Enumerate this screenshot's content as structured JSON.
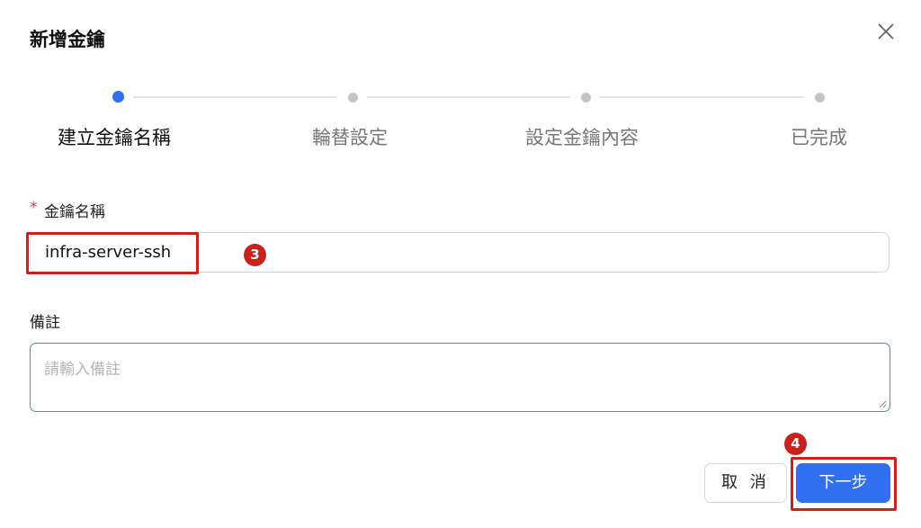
{
  "dialog": {
    "title": "新增金鑰",
    "close_icon": "close-icon"
  },
  "steps": [
    {
      "label": "建立金鑰名稱",
      "state": "active"
    },
    {
      "label": "輪替設定",
      "state": "pending"
    },
    {
      "label": "設定金鑰內容",
      "state": "pending"
    },
    {
      "label": "已完成",
      "state": "pending"
    }
  ],
  "form": {
    "key_name": {
      "required_mark": "*",
      "label": "金鑰名稱",
      "value": "infra-server-ssh"
    },
    "note": {
      "label": "備註",
      "placeholder": "請輸入備註"
    }
  },
  "footer": {
    "cancel_label": "取 消",
    "next_label": "下一步"
  },
  "annotations": {
    "badge_3": "3",
    "badge_4": "4",
    "highlight_color": "#c9221c"
  },
  "colors": {
    "accent": "#2f6ff0",
    "required": "#e03c3c"
  }
}
